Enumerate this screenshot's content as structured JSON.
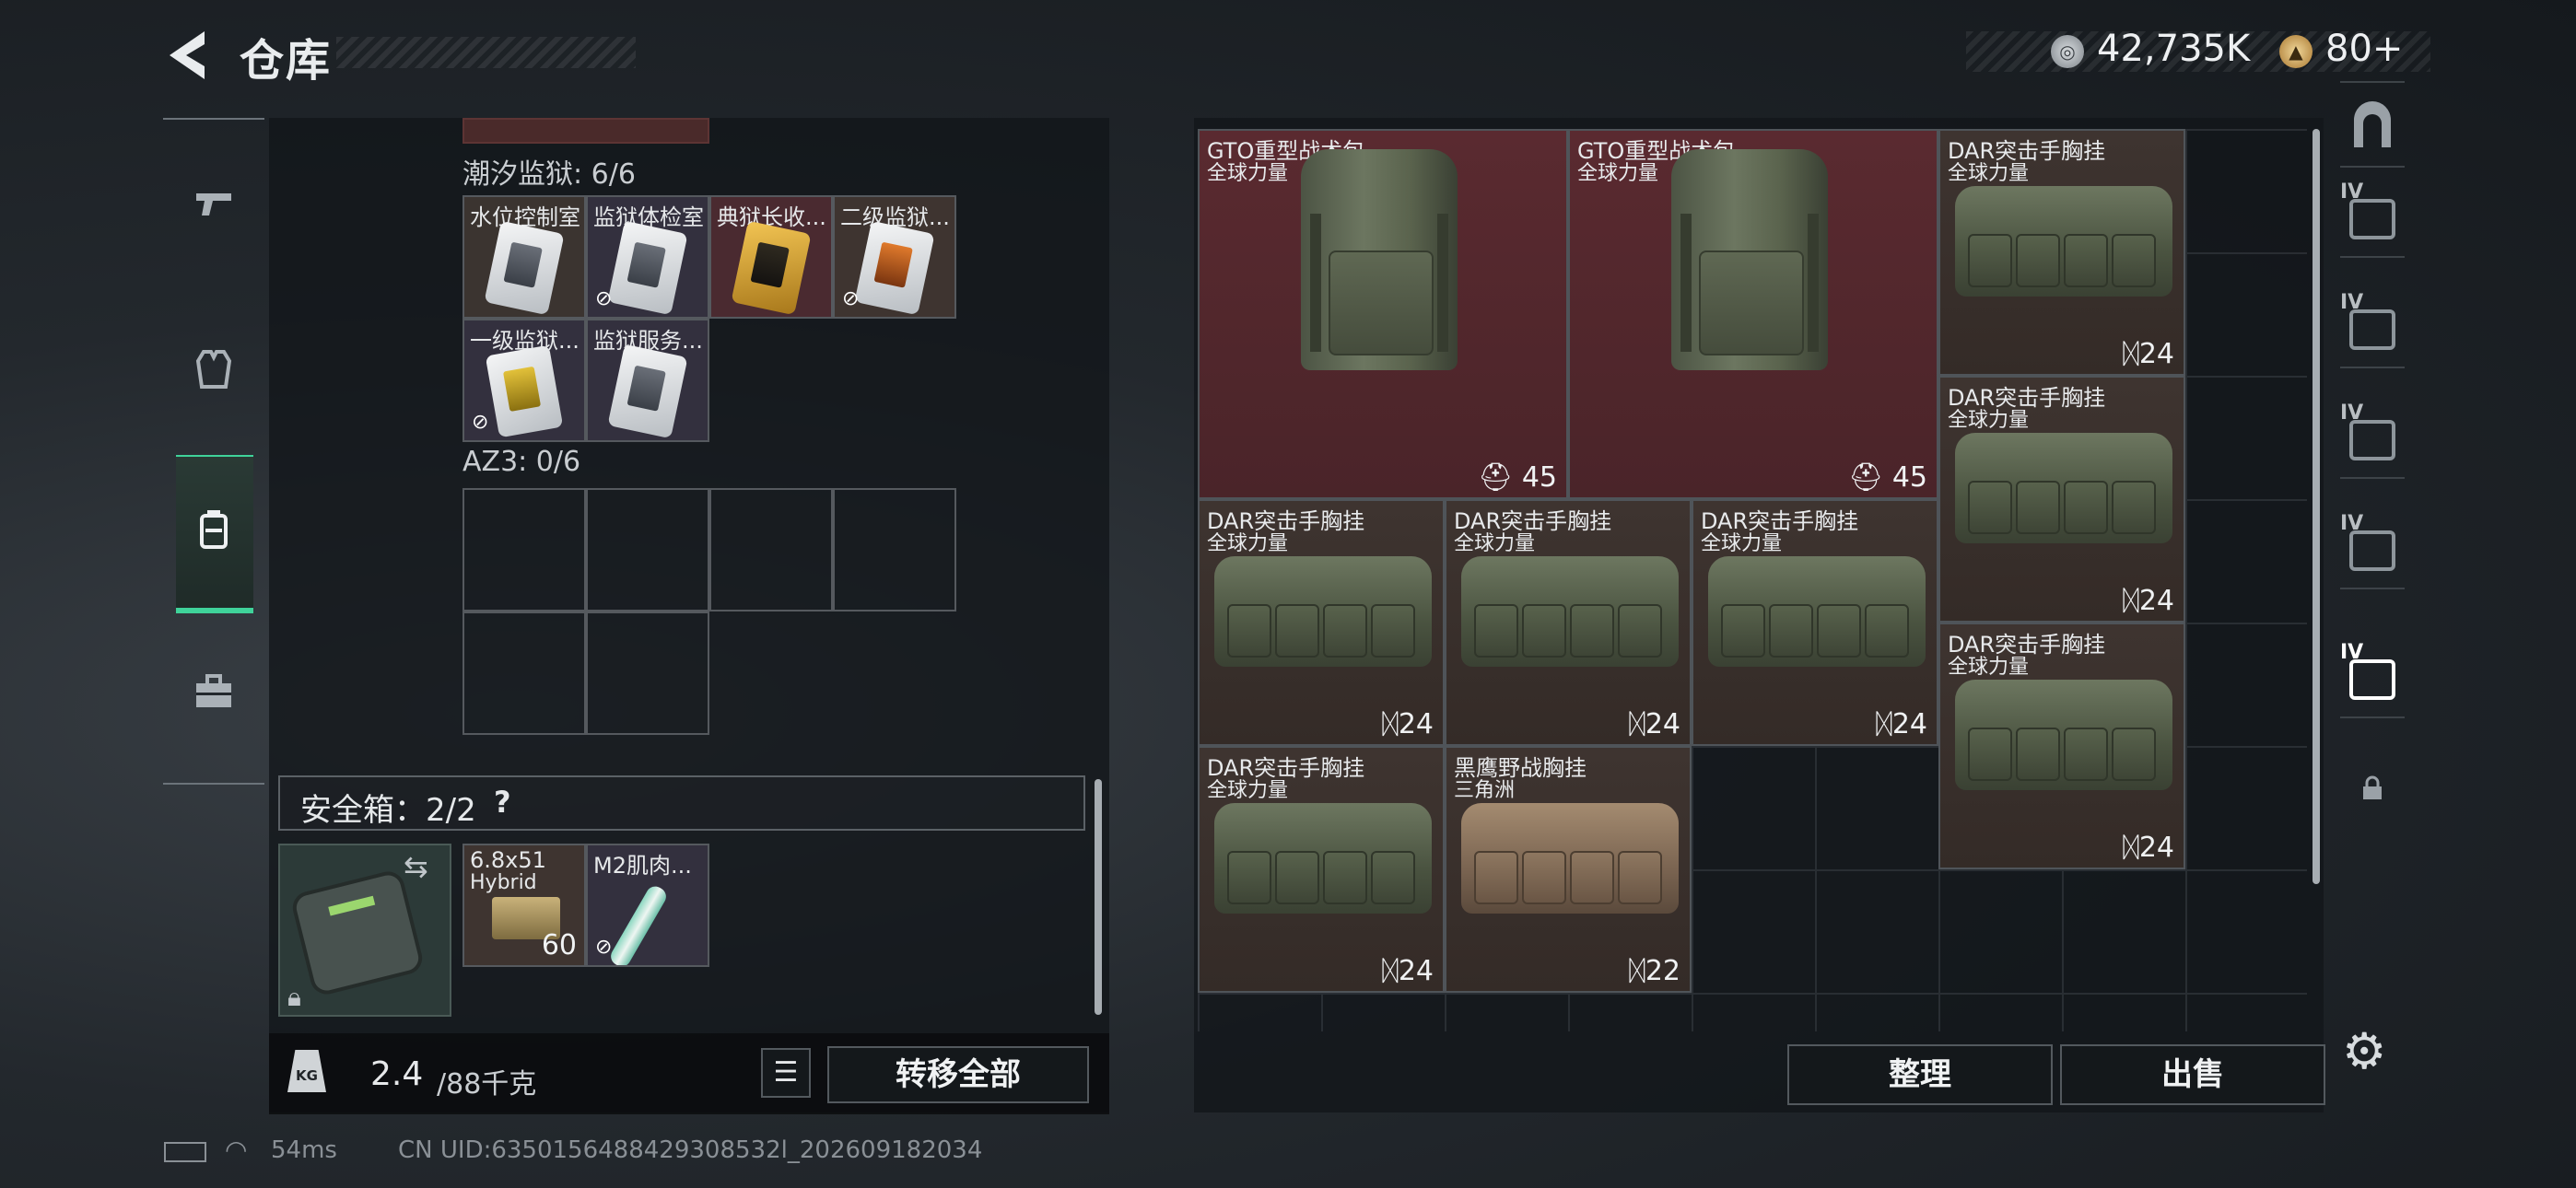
{
  "header": {
    "title": "仓库",
    "back_icon": "back-arrow-icon",
    "currency1": {
      "icon": "silver-coin-icon",
      "value": "42,735K"
    },
    "currency2": {
      "icon": "gold-coin-icon",
      "value": "80+",
      "symbol": "+"
    }
  },
  "left_nav": [
    {
      "icon": "pistol-icon"
    },
    {
      "icon": "armor-vest-icon"
    },
    {
      "icon": "backpack-icon",
      "active": true
    },
    {
      "icon": "toolbox-icon"
    }
  ],
  "containers": [
    {
      "label": "潮汐监狱: 6/6",
      "items": [
        {
          "name": "水位控制室",
          "card": "white",
          "no_transfer": false
        },
        {
          "name": "监狱体检室",
          "card": "white",
          "no_transfer": true
        },
        {
          "name": "典狱长收...",
          "card": "gold",
          "no_transfer": false
        },
        {
          "name": "二级监狱...",
          "card": "orange",
          "no_transfer": true
        },
        {
          "name": "一级监狱...",
          "card": "white",
          "no_transfer": true
        },
        {
          "name": "监狱服务...",
          "card": "white",
          "no_transfer": false
        }
      ]
    },
    {
      "label": "AZ3: 0/6",
      "items": []
    }
  ],
  "safebox": {
    "label": "安全箱：2/2",
    "help": "?",
    "items": [
      {
        "name": "6.8x51",
        "name2": "Hybrid",
        "count": "60"
      },
      {
        "name": "M2肌肉...",
        "no_transfer": true
      }
    ]
  },
  "weight": {
    "icon_text": "KG",
    "current": "2.4",
    "max": "/88千克"
  },
  "buttons": {
    "transfer_all": "转移全部",
    "sort": "整理",
    "sell": "出售"
  },
  "stash_items": [
    {
      "name": "GTO重型战术包",
      "owner": "全球力量",
      "count": "45",
      "count_icon": "capacity-icon",
      "rarity": "red",
      "kind": "backpack"
    },
    {
      "name": "GTO重型战术包",
      "owner": "全球力量",
      "count": "45",
      "count_icon": "capacity-icon",
      "rarity": "red",
      "kind": "backpack"
    },
    {
      "name": "DAR突击手胸挂",
      "owner": "全球力量",
      "count": "24",
      "count_icon": "capacity-icon",
      "rarity": "brown",
      "kind": "bag"
    },
    {
      "name": "DAR突击手胸挂",
      "owner": "全球力量",
      "count": "24",
      "count_icon": "capacity-icon",
      "rarity": "brown",
      "kind": "bag"
    },
    {
      "name": "DAR突击手胸挂",
      "owner": "全球力量",
      "count": "24",
      "count_icon": "capacity-icon",
      "rarity": "brown",
      "kind": "bag"
    },
    {
      "name": "DAR突击手胸挂",
      "owner": "全球力量",
      "count": "24",
      "count_icon": "capacity-icon",
      "rarity": "brown",
      "kind": "bag"
    },
    {
      "name": "DAR突击手胸挂",
      "owner": "全球力量",
      "count": "24",
      "count_icon": "capacity-icon",
      "rarity": "brown",
      "kind": "bag"
    },
    {
      "name": "DAR突击手胸挂",
      "owner": "全球力量",
      "count": "24",
      "count_icon": "capacity-icon",
      "rarity": "brown",
      "kind": "bag"
    },
    {
      "name": "DAR突击手胸挂",
      "owner": "全球力量",
      "count": "24",
      "count_icon": "capacity-icon",
      "rarity": "brown",
      "kind": "bag"
    },
    {
      "name": "黑鹰野战胸挂",
      "owner": "三角洲",
      "count": "22",
      "count_icon": "capacity-icon",
      "rarity": "brown",
      "kind": "bag-tan"
    }
  ],
  "right_tabs": [
    {
      "icon": "arch-icon"
    },
    {
      "icon": "stash-add-icon",
      "level": "IV"
    },
    {
      "icon": "stash-box-icon",
      "level": "IV"
    },
    {
      "icon": "stash-weapon-icon",
      "level": "IV"
    },
    {
      "icon": "stash-folder-icon",
      "level": "IV"
    },
    {
      "icon": "stash-selected-icon",
      "level": "IV",
      "active": true
    },
    {
      "icon": "lock-icon"
    }
  ],
  "status": {
    "ping": "54ms",
    "uid": "CN UID:6350156488429308532l_202609182034"
  },
  "colors": {
    "accent": "#3fd39a",
    "red_rarity": "#5a2a30",
    "brown_rarity": "#3e3430"
  }
}
